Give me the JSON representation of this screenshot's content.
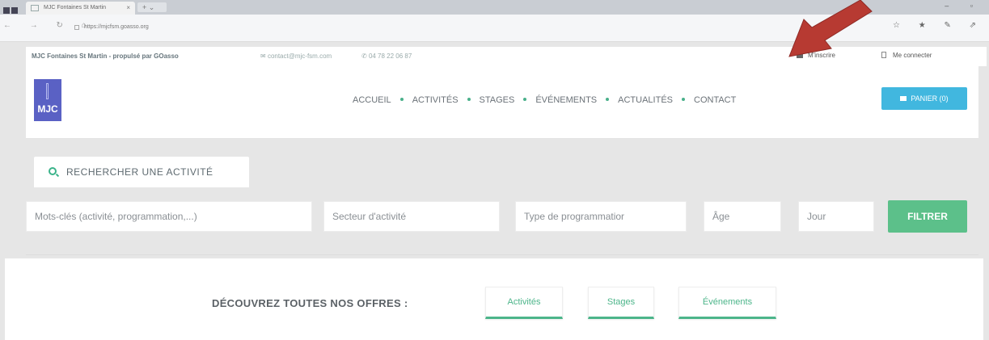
{
  "browser": {
    "tab_title": "MJC Fontaines St Martin",
    "url": "https://mjcfsm.goasso.org"
  },
  "topbar": {
    "site_name": "MJC Fontaines St Martin - propulsé par GOasso",
    "email": "contact@mjc-fsm.com",
    "phone": "04 78 22 06 87",
    "register": "M'inscrire",
    "login": "Me connecter"
  },
  "header": {
    "logo_text": "MJC",
    "nav": [
      "ACCUEIL",
      "ACTIVITÉS",
      "STAGES",
      "ÉVÉNEMENTS",
      "ACTUALITÉS",
      "CONTACT"
    ],
    "cart_label": "PANIER (0)"
  },
  "search": {
    "title": "RECHERCHER UNE ACTIVITÉ",
    "keywords_placeholder": "Mots-clés (activité, programmation,...)",
    "sector_placeholder": "Secteur d'activité",
    "type_placeholder": "Type de programmatior",
    "age_placeholder": "Âge",
    "day_placeholder": "Jour",
    "filter_label": "FILTRER"
  },
  "offers": {
    "label": "DÉCOUVREZ TOUTES NOS OFFRES :",
    "buttons": [
      "Activités",
      "Stages",
      "Événements"
    ]
  },
  "colors": {
    "accent_green": "#4cb58a",
    "cart_blue": "#41b7df",
    "logo_purple": "#5a61c4",
    "arrow_red": "#b73a32"
  }
}
